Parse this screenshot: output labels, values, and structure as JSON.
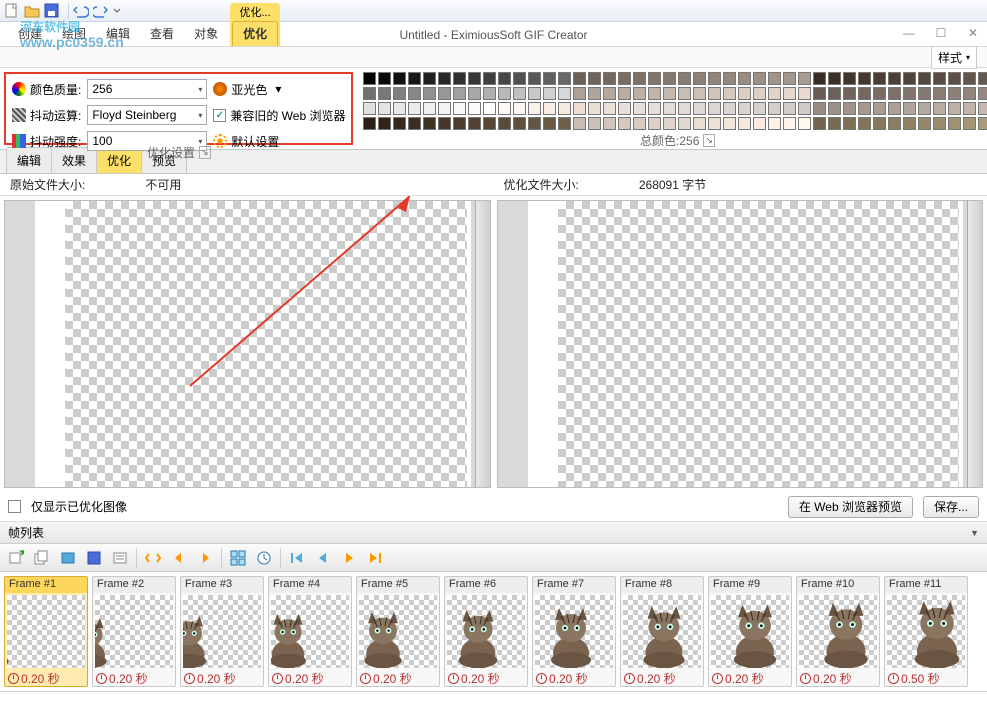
{
  "app_title": "Untitled - EximiousSoft GIF Creator",
  "watermark": {
    "line1": "河东软件园",
    "line2": "www.pc0359.cn"
  },
  "ribbon_tabs": [
    "创建",
    "绘图",
    "编辑",
    "查看",
    "对象"
  ],
  "context_group": {
    "title": "优化...",
    "tab": "优化"
  },
  "win_btns": {
    "min": "—",
    "max": "☐",
    "close": "✕"
  },
  "style_label": "样式",
  "opt": {
    "color_quality_label": "颜色质量:",
    "color_quality_value": "256",
    "matte_label": "亚光色",
    "dither_alg_label": "抖动运算:",
    "dither_alg_value": "Floyd Steinberg",
    "compat_label": "兼容旧的 Web 浏览器",
    "compat_checked": "✓",
    "dither_int_label": "抖动强度:",
    "dither_int_value": "100",
    "defaults_label": "默认设置",
    "group_title": "优化设置"
  },
  "palette": {
    "label": "总颜色:256",
    "rows": [
      [
        "#000000",
        "#080808",
        "#101010",
        "#181818",
        "#202020",
        "#282828",
        "#303030",
        "#383838",
        "#404040",
        "#484848",
        "#505050",
        "#585858",
        "#606060",
        "#686868",
        "#6e6056",
        "#72645a",
        "#76685e",
        "#7a6c62",
        "#7e7066",
        "#82746a",
        "#86786e",
        "#8a7c72",
        "#8e8076",
        "#92847a",
        "#96887e",
        "#9a8c82",
        "#9e9086",
        "#a29488",
        "#a6988c",
        "#aa9c90",
        "#3a2c24",
        "#3e3028",
        "#42342c",
        "#463830",
        "#4a3c34",
        "#4e4038",
        "#52443c",
        "#564840",
        "#5a4c44",
        "#5e5048",
        "#62544c",
        "#665850"
      ],
      [
        "#707070",
        "#787878",
        "#808080",
        "#888888",
        "#909090",
        "#989898",
        "#a0a0a0",
        "#a8a8a8",
        "#b0b0b0",
        "#b8b8b8",
        "#c0c0c0",
        "#c8c8c8",
        "#d0d0d0",
        "#d8d8d8",
        "#aea094",
        "#b2a498",
        "#b6a89c",
        "#baaca0",
        "#beb0a4",
        "#c2b4a8",
        "#c6b8ac",
        "#cabcb0",
        "#cec0b4",
        "#d2c4b8",
        "#d6c8bc",
        "#dacfc0",
        "#decfc4",
        "#e2d3c8",
        "#e6d7cc",
        "#ead9d0",
        "#6a5c54",
        "#6e6058",
        "#72645c",
        "#766860",
        "#7a6c64",
        "#7e7068",
        "#82746c",
        "#867870",
        "#8a7c74",
        "#8e8078",
        "#92847c",
        "#968880"
      ],
      [
        "#e0e0e0",
        "#e4e4e4",
        "#e8e8e8",
        "#ececec",
        "#f0f0f0",
        "#f4f4f4",
        "#f8f8f8",
        "#fcfcfc",
        "#ffffff",
        "#fdfaf6",
        "#fbf6f0",
        "#f9f2ea",
        "#f7eee4",
        "#f5eade",
        "#eeded2",
        "#ece0d4",
        "#eae0d6",
        "#e8e0d8",
        "#e6e0da",
        "#e4dedc",
        "#e2dcda",
        "#e0dad8",
        "#ded8d6",
        "#dcd6d4",
        "#dad4d2",
        "#d8d2d0",
        "#d6d0ce",
        "#d4cecc",
        "#d2ccca",
        "#d0cac8",
        "#9a8c84",
        "#9e9088",
        "#a2948c",
        "#a69890",
        "#aa9c94",
        "#aea098",
        "#b2a49c",
        "#b6a8a0",
        "#baaca4",
        "#beb0a8",
        "#c2b4ac",
        "#c6b8b0"
      ],
      [
        "#2d1e16",
        "#32231a",
        "#37281e",
        "#3c2d22",
        "#413226",
        "#46372a",
        "#4b3c2e",
        "#504132",
        "#554636",
        "#5a4b3a",
        "#5f503e",
        "#645542",
        "#695a46",
        "#6e5f4a",
        "#cabcb2",
        "#cec0b6",
        "#d2c4ba",
        "#d6c8be",
        "#dacbc2",
        "#decfc6",
        "#e2d3ca",
        "#e6d7ce",
        "#eaddd2",
        "#eee1d6",
        "#f2e5da",
        "#f6e9de",
        "#faeae2",
        "#fef1e6",
        "#fff5ea",
        "#fff9ee",
        "#73644e",
        "#786952",
        "#7d6e56",
        "#82735a",
        "#87785e",
        "#8c7d62",
        "#918266",
        "#96876a",
        "#9b8c6e",
        "#a09172",
        "#a59676",
        "#aa9b7a"
      ]
    ]
  },
  "subtabs": {
    "items": [
      "编辑",
      "效果",
      "优化",
      "预览"
    ],
    "active": 2
  },
  "info": {
    "orig_label": "原始文件大小:",
    "orig_value": "不可用",
    "opt_label": "优化文件大小:",
    "opt_value": "268091 字节"
  },
  "under": {
    "chk_label": "仅显示已优化图像",
    "btn_preview": "在 Web 浏览器预览",
    "btn_save": "保存..."
  },
  "frames_title": "帧列表",
  "frames": [
    {
      "label": "Frame #1",
      "time": "0.20 秒",
      "sel": true,
      "size": 0
    },
    {
      "label": "Frame #2",
      "time": "0.20 秒",
      "sel": false,
      "size": 1
    },
    {
      "label": "Frame #3",
      "time": "0.20 秒",
      "sel": false,
      "size": 2
    },
    {
      "label": "Frame #4",
      "time": "0.20 秒",
      "sel": false,
      "size": 3
    },
    {
      "label": "Frame #5",
      "time": "0.20 秒",
      "sel": false,
      "size": 4
    },
    {
      "label": "Frame #6",
      "time": "0.20 秒",
      "sel": false,
      "size": 5
    },
    {
      "label": "Frame #7",
      "time": "0.20 秒",
      "sel": false,
      "size": 6
    },
    {
      "label": "Frame #8",
      "time": "0.20 秒",
      "sel": false,
      "size": 7
    },
    {
      "label": "Frame #9",
      "time": "0.20 秒",
      "sel": false,
      "size": 8
    },
    {
      "label": "Frame #10",
      "time": "0.20 秒",
      "sel": false,
      "size": 9
    },
    {
      "label": "Frame #11",
      "time": "0.50 秒",
      "sel": false,
      "size": 10
    }
  ]
}
